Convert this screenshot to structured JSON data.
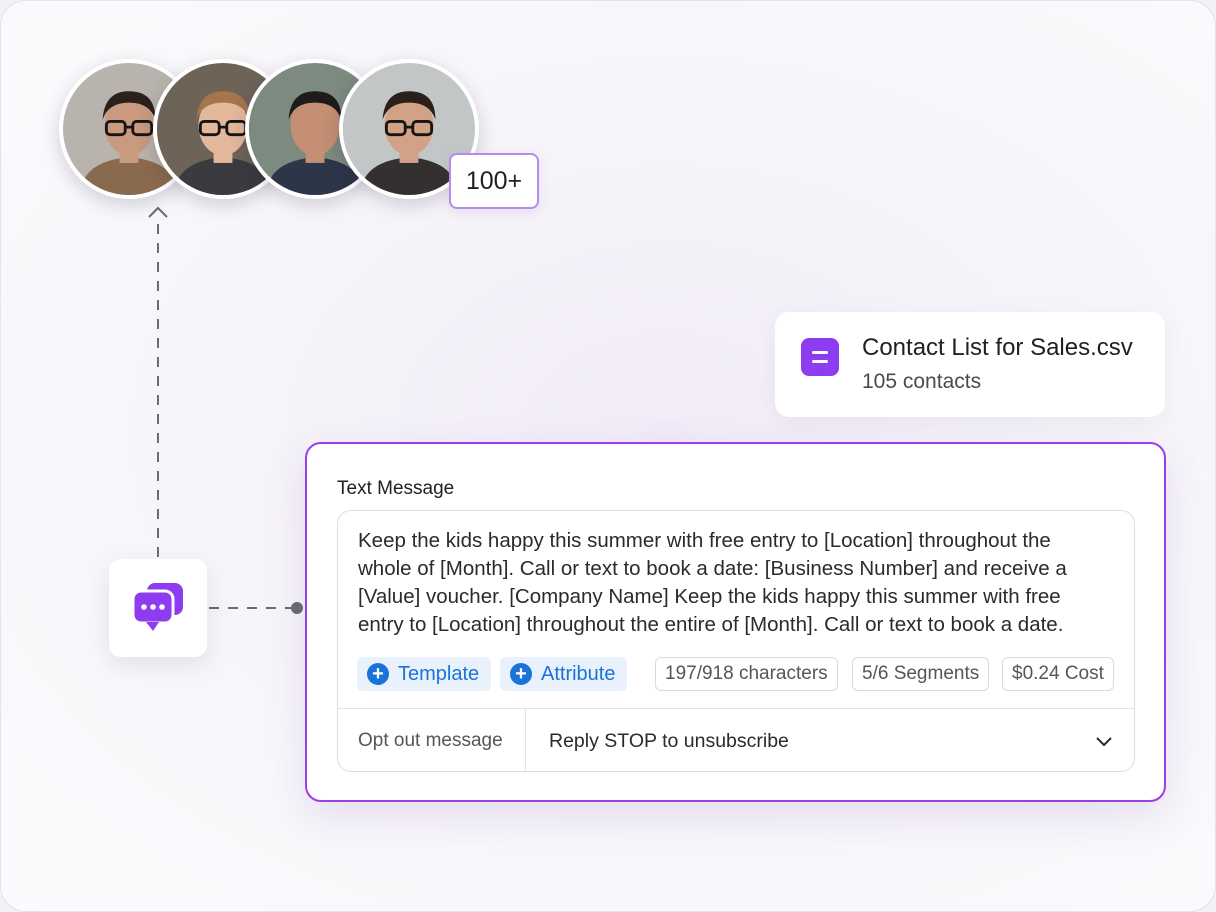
{
  "recipients": {
    "avatars": [
      {
        "name": "avatar-man-glasses-beard",
        "skin": "#c99a7e",
        "hair": "#2b211c",
        "bg": "#b9b3ad",
        "shirt": "#8a6a4e",
        "glasses": true
      },
      {
        "name": "avatar-woman-glasses",
        "skin": "#e4b89b",
        "hair": "#a5764b",
        "bg": "#6e6357",
        "shirt": "#3b3a3f",
        "glasses": true
      },
      {
        "name": "avatar-man-suit",
        "skin": "#c48f72",
        "hair": "#1e1b1a",
        "bg": "#7c8a80",
        "shirt": "#2d3548",
        "glasses": false
      },
      {
        "name": "avatar-man-glasses-office",
        "skin": "#d1a285",
        "hair": "#2a201a",
        "bg": "#c3c6c7",
        "shirt": "#33302f",
        "glasses": true
      }
    ],
    "count_badge": "100+"
  },
  "contact_list": {
    "icon": "list-file-icon",
    "title": "Contact List for Sales.csv",
    "subtitle": "105 contacts"
  },
  "channel_icon": "chat-bubbles-icon",
  "message": {
    "label": "Text Message",
    "body": "Keep the kids happy this summer with free entry to [Location] throughout the whole of [Month]. Call or text to book a date: [Business Number] and receive a [Value] voucher. [Company Name] Keep the kids happy this summer with free entry to [Location] throughout the entire of [Month]. Call or text to book a date.",
    "template_label": "Template",
    "attribute_label": "Attribute",
    "characters": "197/918 characters",
    "segments": "5/6 Segments",
    "cost": "$0.24 Cost",
    "optout_label": "Opt out message",
    "optout_value": "Reply STOP to unsubscribe"
  },
  "colors": {
    "accent": "#8d3cf0",
    "card_border": "#9a3fe8",
    "chip_blue": "#1a73d9",
    "badge_border": "#b98be8"
  }
}
